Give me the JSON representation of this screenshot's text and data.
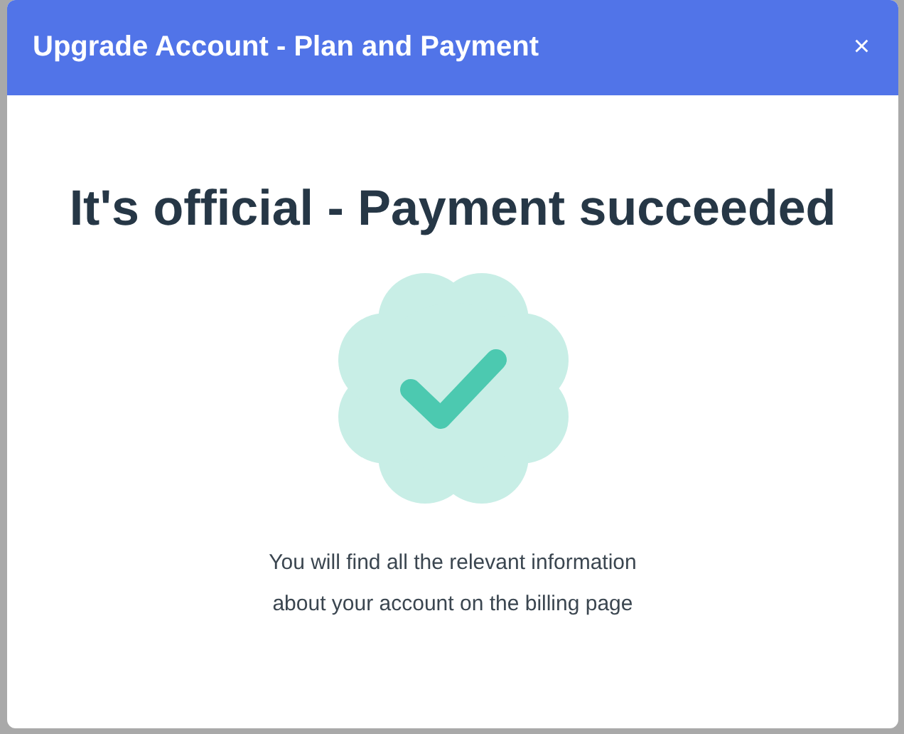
{
  "dialog": {
    "title": "Upgrade Account - Plan and Payment",
    "close": "×"
  },
  "heading": "It's official - Payment succeeded",
  "message": [
    "You will find all the relevant information",
    "about your account on the billing page"
  ]
}
